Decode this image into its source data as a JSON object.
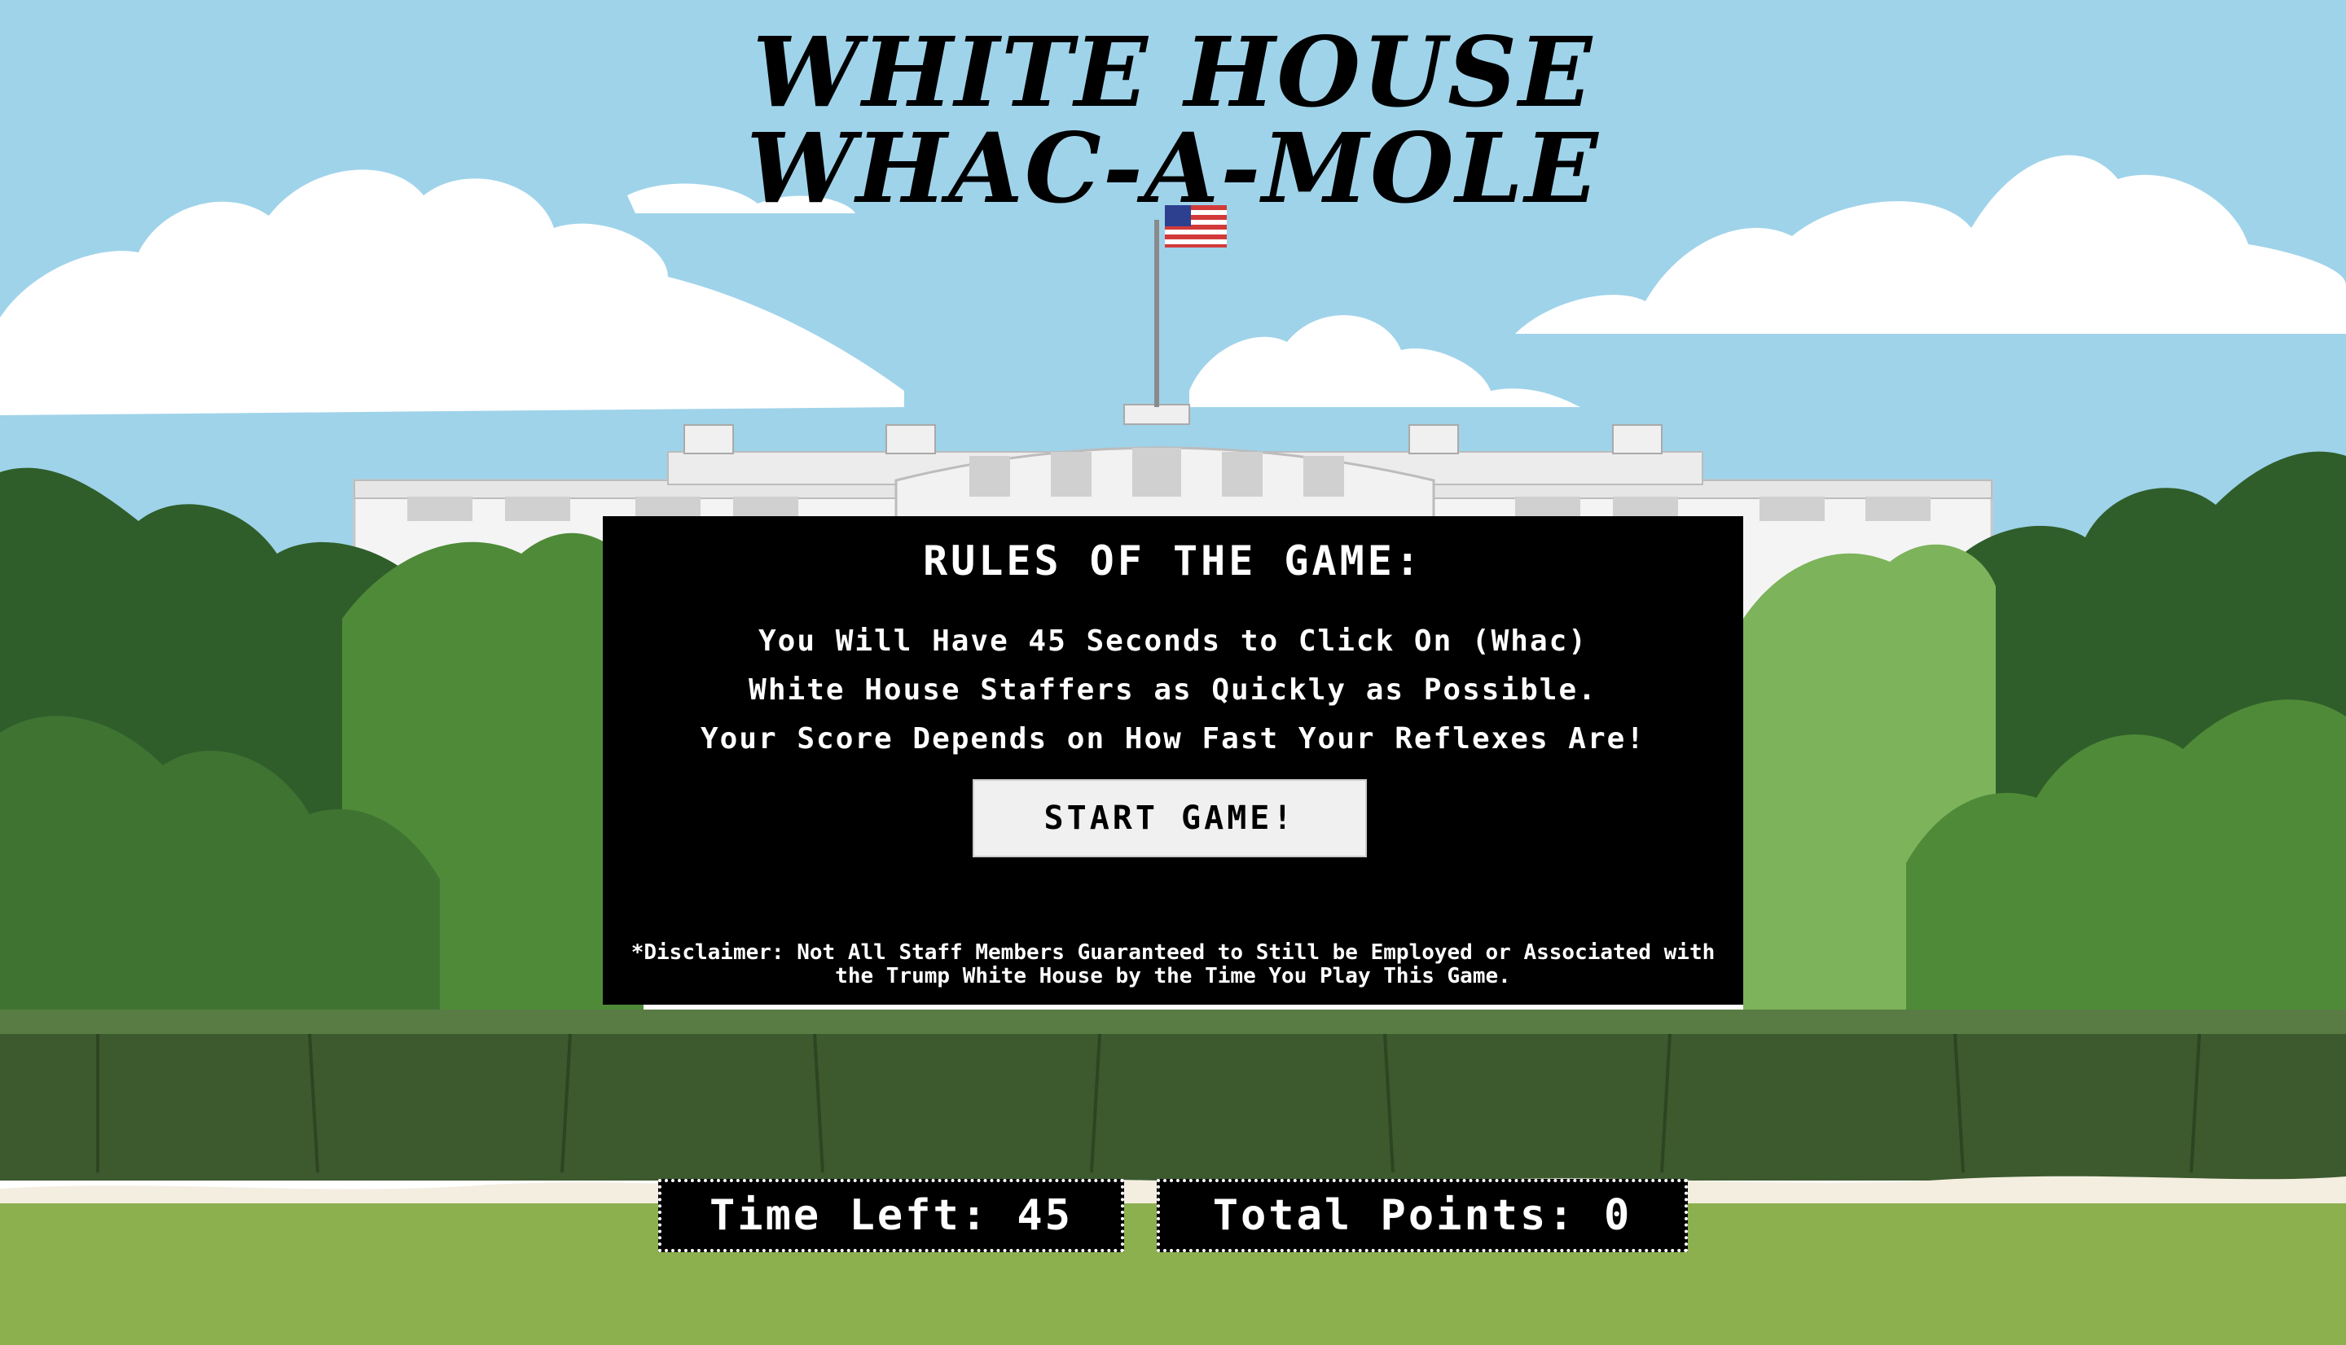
{
  "title": {
    "line1": "WHITE HOUSE",
    "line2": "WHAC-A-MOLE"
  },
  "rules": {
    "heading": "RULES OF THE GAME:",
    "lines": [
      "You Will Have 45 Seconds to Click On (Whac)",
      "White House Staffers as Quickly as Possible.",
      "Your Score Depends on How Fast Your Reflexes Are!"
    ],
    "start_button": "START GAME!",
    "disclaimer": "*Disclaimer: Not All Staff Members Guaranteed to Still be Employed or Associated with the Trump White House by the Time You Play This Game."
  },
  "hud": {
    "time_label": "Time Left:",
    "time_value": "45",
    "points_label": "Total Points:",
    "points_value": "0"
  },
  "colors": {
    "sky": "#9fd3ea",
    "cloud": "#ffffff",
    "tree_dark": "#2f5e2a",
    "tree_mid": "#4f8a38",
    "tree_light": "#7db35a",
    "hedge": "#3c5a2e",
    "lawn": "#8db04f",
    "building": "#f4f4f4",
    "panel": "#000000",
    "button": "#f0f0f0"
  },
  "icons": {
    "flag": "us-flag-icon"
  }
}
